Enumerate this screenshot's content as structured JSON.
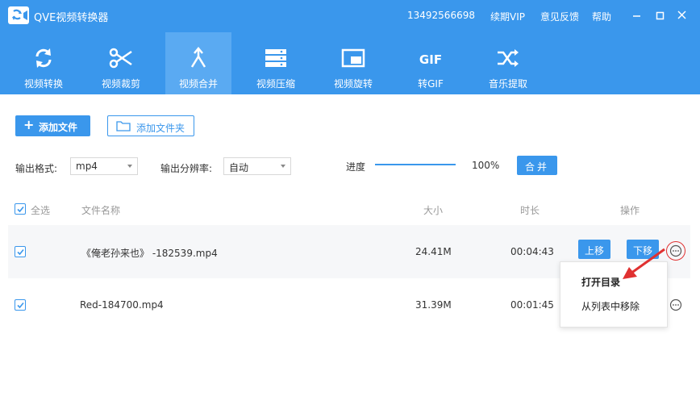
{
  "window": {
    "title": "QVE视频转换器",
    "phone": "13492566698",
    "renew_vip": "续期VIP",
    "feedback": "意见反馈",
    "help": "帮助"
  },
  "tools": [
    {
      "label": "视频转换",
      "icon": "convert-icon"
    },
    {
      "label": "视频裁剪",
      "icon": "scissors-icon"
    },
    {
      "label": "视频合并",
      "icon": "merge-icon",
      "active": true
    },
    {
      "label": "视频压缩",
      "icon": "compress-icon"
    },
    {
      "label": "视频旋转",
      "icon": "rotate-icon"
    },
    {
      "label": "转GIF",
      "icon": "gif-icon"
    },
    {
      "label": "音乐提取",
      "icon": "shuffle-icon"
    }
  ],
  "actions": {
    "add_file": "添加文件",
    "add_folder": "添加文件夹",
    "merge": "合并"
  },
  "settings": {
    "format_label": "输出格式:",
    "format_value": "mp4",
    "resolution_label": "输出分辨率:",
    "resolution_value": "自动",
    "progress_label": "进度",
    "progress_value": "100%"
  },
  "table": {
    "headers": {
      "select_all": "全选",
      "name": "文件名称",
      "size": "大小",
      "duration": "时长",
      "operation": "操作"
    },
    "rows": [
      {
        "name": "《俺老孙来也》 -182539.mp4",
        "size": "24.41M",
        "duration": "00:04:43",
        "checked": true
      },
      {
        "name": "Red-184700.mp4",
        "size": "31.39M",
        "duration": "00:01:45",
        "checked": true
      }
    ],
    "move_up": "上移",
    "move_down": "下移"
  },
  "context_menu": {
    "open_folder": "打开目录",
    "remove": "从列表中移除"
  },
  "colors": {
    "accent": "#3a97ec",
    "active_tab": "#5aaaf2",
    "annotation": "#e03131"
  }
}
